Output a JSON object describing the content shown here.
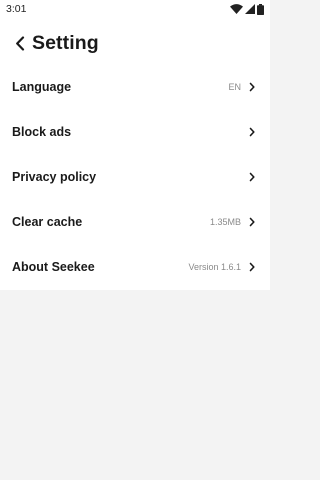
{
  "status_bar": {
    "time": "3:01",
    "icons": [
      "wifi-icon",
      "cellular-signal-icon",
      "battery-icon"
    ]
  },
  "header": {
    "title": "Setting",
    "back_icon": "chevron-left-icon"
  },
  "settings": [
    {
      "key": "language",
      "label": "Language",
      "value": "EN"
    },
    {
      "key": "block-ads",
      "label": "Block ads",
      "value": ""
    },
    {
      "key": "privacy-policy",
      "label": "Privacy policy",
      "value": ""
    },
    {
      "key": "clear-cache",
      "label": "Clear cache",
      "value": "1.35MB"
    },
    {
      "key": "about",
      "label": "About Seekee",
      "value": "Version 1.6.1"
    }
  ],
  "colors": {
    "background": "#f3f3f3",
    "panel": "#ffffff",
    "text": "#1a1a1a",
    "secondary_text": "#8a8a8a"
  }
}
